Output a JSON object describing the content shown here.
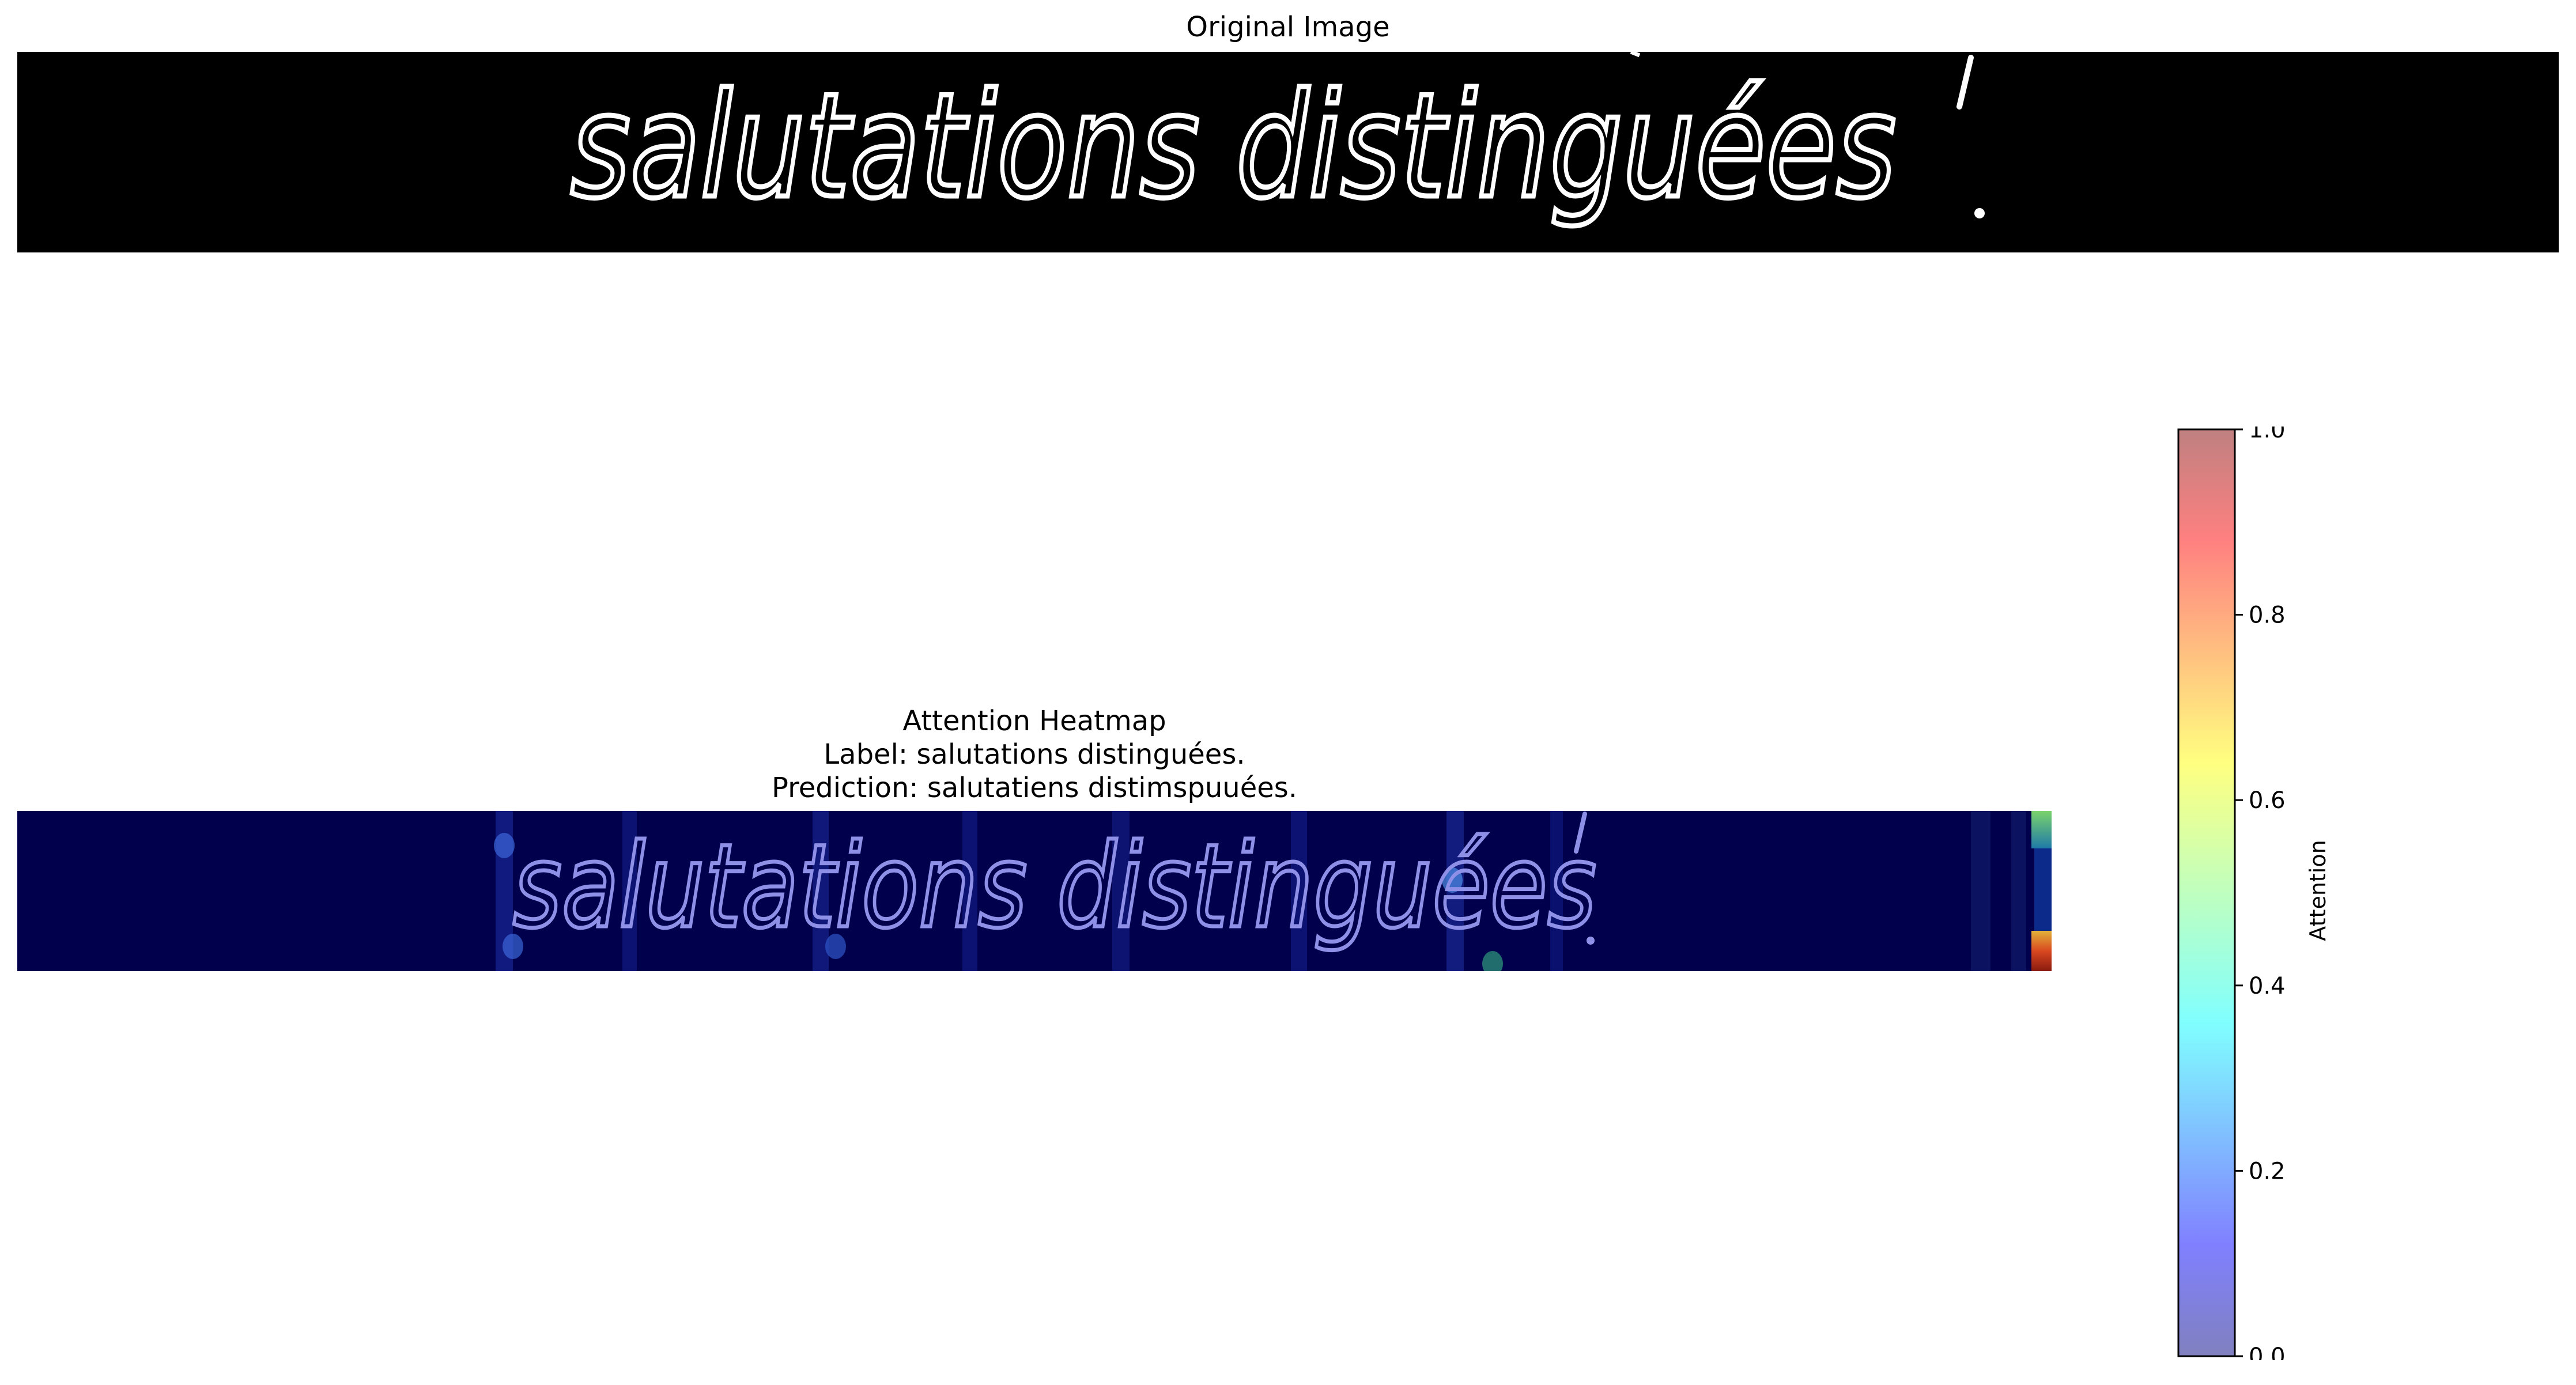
{
  "figure": {
    "original_title": "Original Image",
    "heatmap_title": "Attention Heatmap",
    "heatmap_label_line": "Label: salutations distinguées.",
    "heatmap_prediction_line": "Prediction: salutatiens distimspuuées.",
    "handwriting_text": "salutations distinguées",
    "colors": {
      "original_background": "#000000",
      "handwriting_stroke": "#ffffff",
      "heatmap_background": "#00004c",
      "heatmap_stroke": "#8e8fe6"
    }
  },
  "chart_data": [
    {
      "type": "heatmap",
      "title": "Attention Heatmap\nLabel: salutations distinguées.\nPrediction: salutatiens distimspuuées.",
      "colormap": "jet",
      "overlay_alpha": 0.5,
      "value_range": [
        0.0,
        1.0
      ],
      "colorbar": {
        "label": "Attention",
        "ticks": [
          0.0,
          0.2,
          0.4,
          0.6,
          0.8,
          1.0
        ],
        "tick_labels": [
          "0.0",
          "0.2",
          "0.4",
          "0.6",
          "0.8",
          "1.0"
        ],
        "position": "right"
      },
      "hotspots": [
        {
          "location": "right edge, top",
          "value": 0.55
        },
        {
          "location": "right edge, bottom",
          "value": 0.95
        },
        {
          "location": "word 'salutations' start",
          "value": 0.25
        },
        {
          "location": "word 'distinguées' middle",
          "value": 0.3
        }
      ],
      "grid": false
    }
  ]
}
